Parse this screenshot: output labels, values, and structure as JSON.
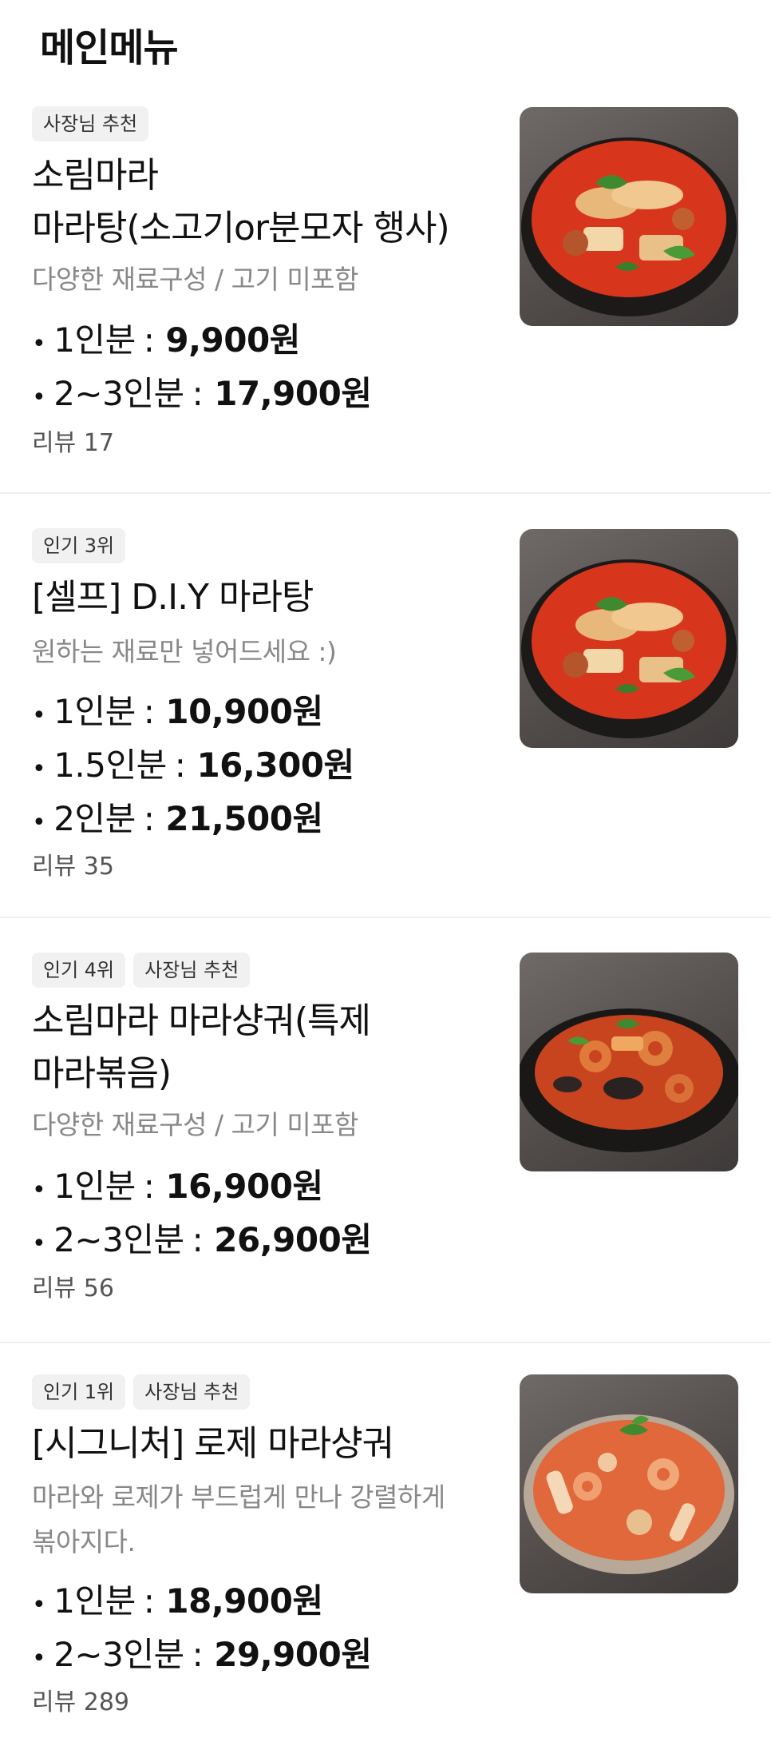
{
  "header": {
    "title": "메인메뉴"
  },
  "items": [
    {
      "badges": [
        "사장님 추천"
      ],
      "name_lines": [
        "소림마라",
        "마라탕(소고기or분모자 행사)"
      ],
      "desc_lines": [
        "다양한 재료구성 / 고기 미포함"
      ],
      "prices": [
        {
          "label": "1인분",
          "value": "9,900원"
        },
        {
          "label": "2~3인분",
          "value": "17,900원"
        }
      ],
      "review": "리뷰 17",
      "image": "maratang-bowl"
    },
    {
      "badges": [
        "인기 3위"
      ],
      "name_lines": [
        "[셀프] D.I.Y 마라탕"
      ],
      "desc_lines": [
        "원하는 재료만 넣어드세요 :)"
      ],
      "prices": [
        {
          "label": "1인분",
          "value": "10,900원"
        },
        {
          "label": "1.5인분",
          "value": "16,300원"
        },
        {
          "label": "2인분",
          "value": "21,500원"
        }
      ],
      "review": "리뷰 35",
      "image": "maratang-bowl"
    },
    {
      "badges": [
        "인기 4위",
        "사장님 추천"
      ],
      "name_lines": [
        "소림마라 마라샹궈(특제",
        "마라볶음)"
      ],
      "desc_lines": [
        "다양한 재료구성 / 고기 미포함"
      ],
      "prices": [
        {
          "label": "1인분",
          "value": "16,900원"
        },
        {
          "label": "2~3인분",
          "value": "26,900원"
        }
      ],
      "review": "리뷰 56",
      "image": "malaxiangguo-plate"
    },
    {
      "badges": [
        "인기 1위",
        "사장님 추천"
      ],
      "name_lines": [
        "[시그니처] 로제 마라샹궈"
      ],
      "desc_lines": [
        "마라와 로제가 부드럽게 만나 강렬하게",
        "볶아지다."
      ],
      "prices": [
        {
          "label": "1인분",
          "value": "18,900원"
        },
        {
          "label": "2~3인분",
          "value": "29,900원"
        }
      ],
      "review": "리뷰 289",
      "image": "rose-malaxiangguo-plate"
    }
  ],
  "colors": {
    "text": "#111111",
    "muted": "#888888",
    "badge_bg": "#f1f1f1",
    "divider": "#f0f0f0",
    "broth_red": "#d8361c",
    "rose_sauce": "#e0683a"
  }
}
